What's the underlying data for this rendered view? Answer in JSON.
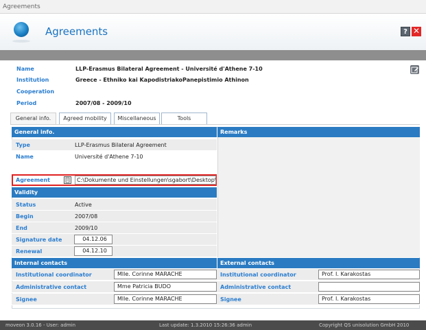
{
  "window": {
    "title": "Agreements"
  },
  "header": {
    "title": "Agreements",
    "help_label": "?",
    "close_label": "✕"
  },
  "summary": {
    "name_label": "Name",
    "name_value": "LLP-Erasmus Bilateral Agreement - Université d'Athene 7-10",
    "institution_label": "Institution",
    "institution_value": "Greece - Ethniko kai KapodistriakoPanepistimio Athinon",
    "cooperation_label": "Cooperation",
    "cooperation_value": "",
    "period_label": "Period",
    "period_value": "2007/08 - 2009/10"
  },
  "tabs": [
    {
      "label": "General info.",
      "active": true
    },
    {
      "label": "Agreed mobility",
      "active": false
    },
    {
      "label": "Miscellaneous",
      "active": false
    },
    {
      "label": "Tools",
      "active": false
    }
  ],
  "general": {
    "heading": "General info.",
    "type_label": "Type",
    "type_value": "LLP-Erasmus Bilateral Agreement",
    "name_label": "Name",
    "name_value": "Université d'Athene 7-10",
    "agreement_label": "Agreement",
    "agreement_path": "C:\\Dokumente und Einstellungen\\sgabort\\Desktop\\agreement"
  },
  "remarks": {
    "heading": "Remarks"
  },
  "validity": {
    "heading": "Validity",
    "status_label": "Status",
    "status_value": "Active",
    "begin_label": "Begin",
    "begin_value": "2007/08",
    "end_label": "End",
    "end_value": "2009/10",
    "signature_label": "Signature date",
    "signature_value": "04.12.06",
    "renewal_label": "Renewal",
    "renewal_value": "04.12.10"
  },
  "internal_contacts": {
    "heading": "Internal contacts",
    "coordinator_label": "Institutional coordinator",
    "coordinator_value": "Mlle. Corinne MARACHE",
    "admin_label": "Administrative contact",
    "admin_value": "Mme Patricia BUDO",
    "signee_label": "Signee",
    "signee_value": "Mlle. Corinne MARACHE"
  },
  "external_contacts": {
    "heading": "External contacts",
    "coordinator_label": "Institutional coordinator",
    "coordinator_value": "Prof. I. Karakostas",
    "admin_label": "Administrative contact",
    "admin_value": "",
    "signee_label": "Signee",
    "signee_value": "Prof. I. Karakostas"
  },
  "footer": {
    "version": "moveon 3.0.16 - User: admin",
    "last_update": "Last update: 1.3.2010 15:26:36 admin",
    "copyright": "Copyright QS unisolution GmbH 2010"
  },
  "colors": {
    "accent": "#2a7bc2",
    "highlight_border": "#e02020",
    "close": "#e32727"
  }
}
